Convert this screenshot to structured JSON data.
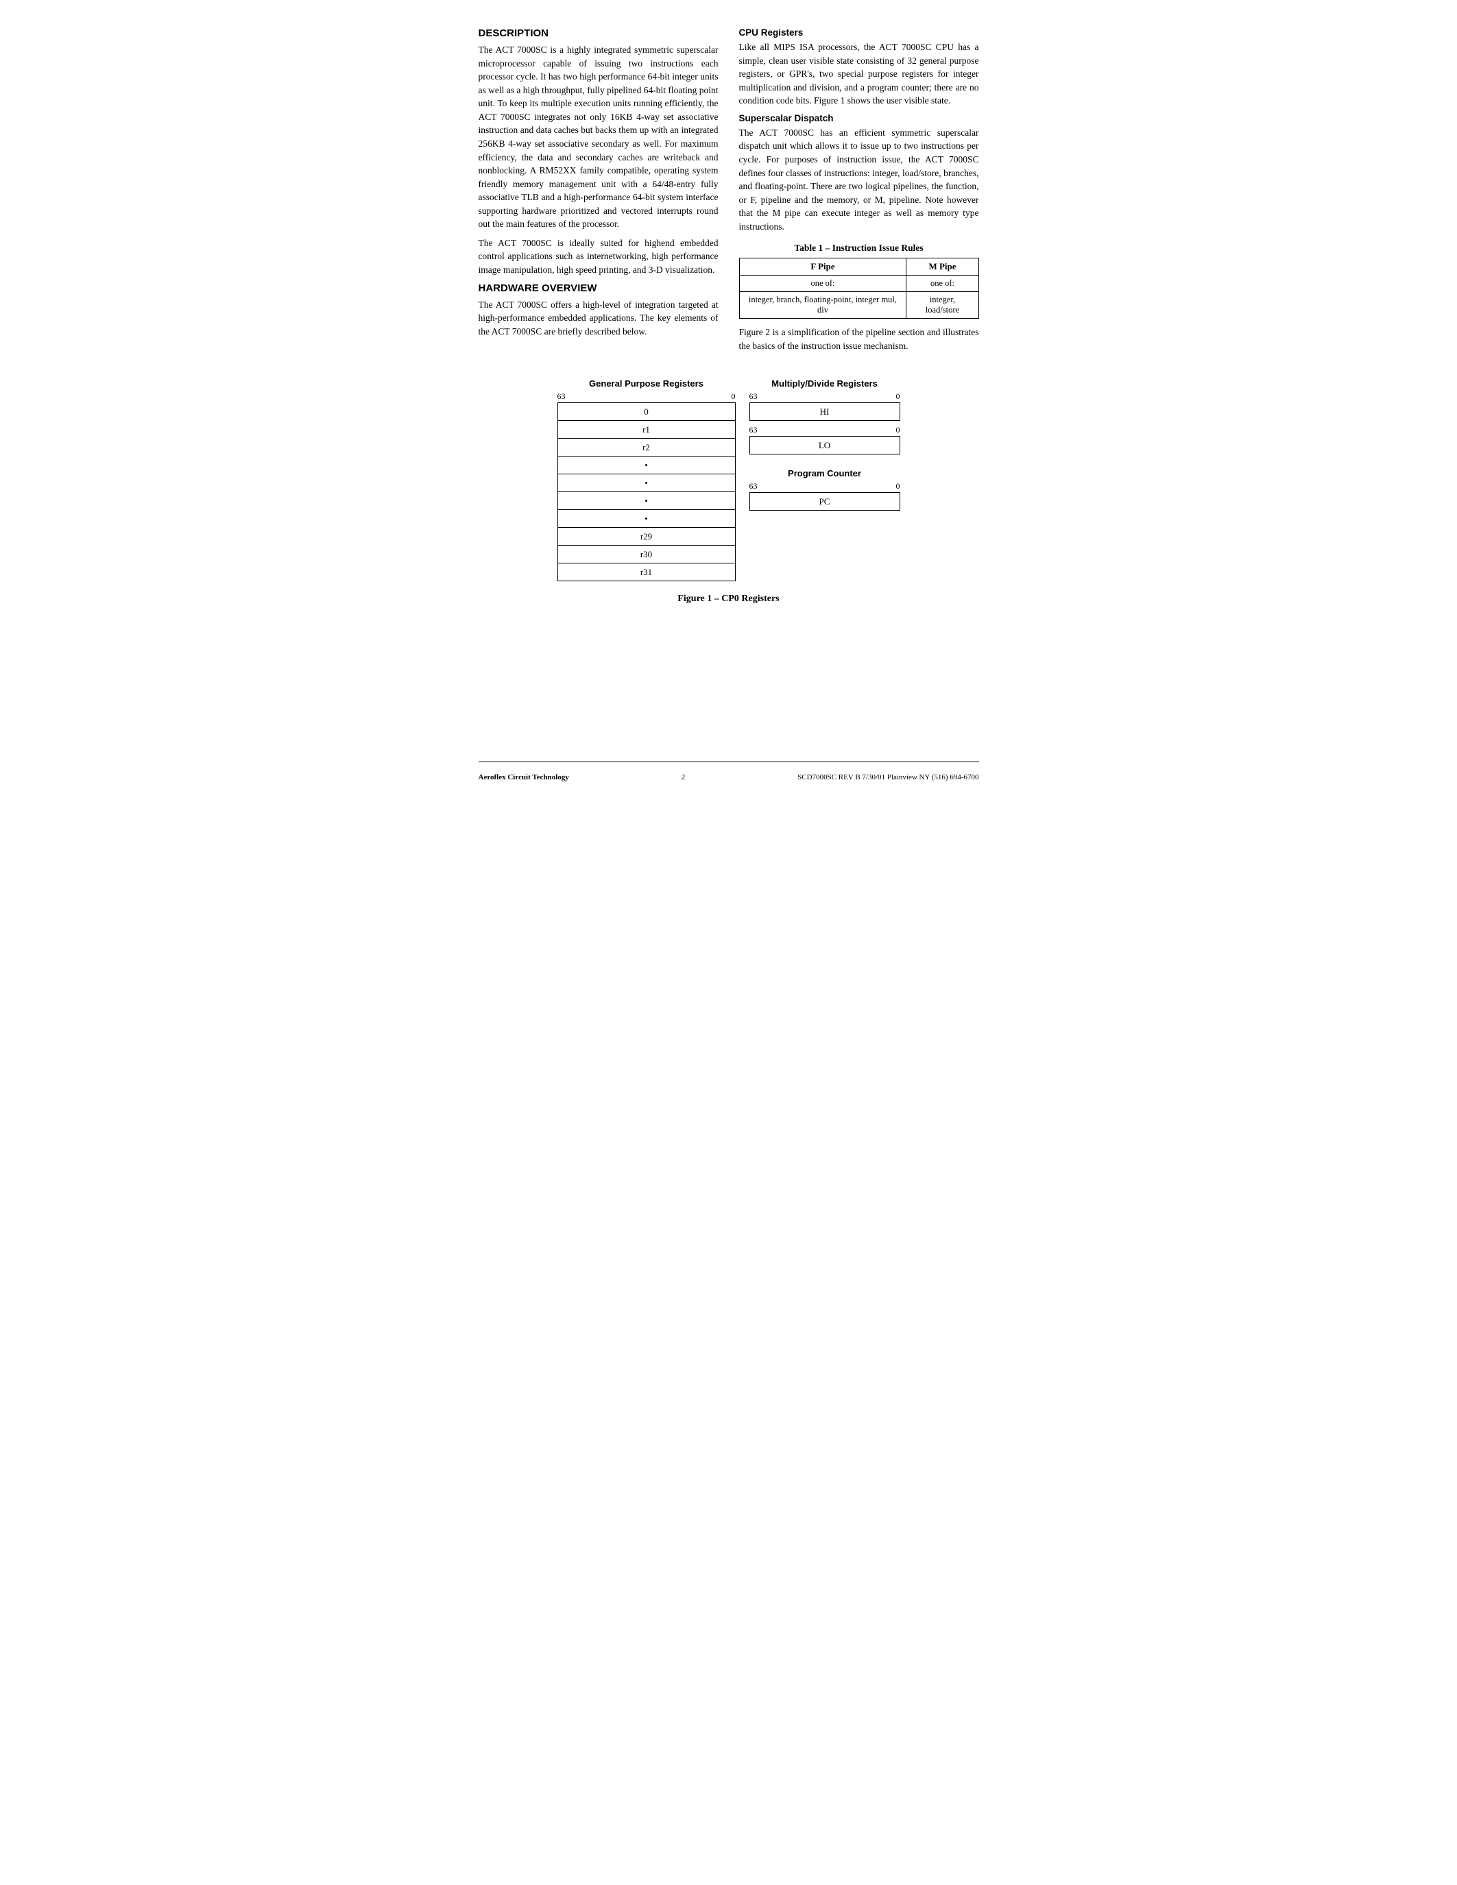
{
  "page": {
    "sections": {
      "description": {
        "title": "DESCRIPTION",
        "paragraphs": [
          "The ACT 7000SC is a highly integrated symmetric superscalar microprocessor capable of issuing two instructions each processor cycle. It has two high performance 64-bit integer units as well as a high throughput, fully pipelined 64-bit floating point unit. To keep its multiple execution units running efficiently, the ACT 7000SC integrates not only 16KB 4-way set associative instruction and data caches but backs them up with an integrated 256KB 4-way set associative secondary as well. For maximum efficiency, the data and secondary caches are writeback and nonblocking. A RM52XX family compatible, operating system friendly memory management unit with a 64/48-entry fully associative TLB and a high-performance 64-bit system interface supporting hardware prioritized and vectored interrupts round out the main features of the processor.",
          "The ACT 7000SC is ideally suited for highend embedded control applications such as internetworking, high performance image manipulation, high speed printing, and 3-D visualization."
        ]
      },
      "hardware_overview": {
        "title": "HARDWARE OVERVIEW",
        "paragraphs": [
          "The ACT 7000SC offers a high-level of integration targeted at high-performance embedded applications. The key elements of the ACT 7000SC are briefly described below."
        ]
      },
      "cpu_registers": {
        "title": "CPU Registers",
        "paragraphs": [
          "Like all MIPS ISA processors, the ACT 7000SC CPU has a simple, clean user visible state consisting of 32 general purpose registers, or GPR's, two special purpose registers for integer multiplication and division, and a program counter; there are no condition code bits. Figure 1 shows the user visible state."
        ]
      },
      "superscalar_dispatch": {
        "title": "Superscalar Dispatch",
        "paragraphs": [
          "The ACT 7000SC has an efficient symmetric superscalar dispatch unit which allows it to issue up to two instructions per cycle. For purposes of instruction issue, the ACT 7000SC defines four classes of instructions: integer, load/store, branches, and floating-point. There are two logical pipelines, the function, or F, pipeline and the memory, or M, pipeline. Note however that the M pipe can execute integer as well as memory type instructions."
        ]
      },
      "instruction_issue_rules": {
        "table_title": "Table 1 – Instruction Issue Rules",
        "headers": [
          "F Pipe",
          "M Pipe"
        ],
        "rows": [
          [
            "one of:",
            "one of:"
          ],
          [
            "integer, branch, floating-point, integer mul, div",
            "integer, load/store"
          ]
        ]
      },
      "pipeline_note": "Figure 2 is a simplification of the pipeline section and illustrates the basics of the instruction issue mechanism."
    },
    "diagrams": {
      "gpr": {
        "label": "General Purpose Registers",
        "bit_high": "63",
        "bit_low": "0",
        "rows": [
          "0",
          "r1",
          "r2",
          "•",
          "•",
          "•",
          "•",
          "r29",
          "r30",
          "r31"
        ]
      },
      "multiply_divide": {
        "label": "Multiply/Divide Registers",
        "bit_high": "63",
        "bit_low": "0",
        "registers": [
          {
            "bits_high": "63",
            "bits_low": "0",
            "name": "HI"
          },
          {
            "bits_high": "63",
            "bits_low": "0",
            "name": "LO"
          }
        ]
      },
      "program_counter": {
        "label": "Program Counter",
        "bit_high": "63",
        "bit_low": "0",
        "name": "PC"
      }
    },
    "figure_caption": "Figure 1 – CP0 Registers",
    "footer": {
      "left": "Aeroflex Circuit Technology",
      "center": "2",
      "right": "SCD7000SC REV B  7/30/01  Plainview NY (516) 694-6700"
    }
  }
}
